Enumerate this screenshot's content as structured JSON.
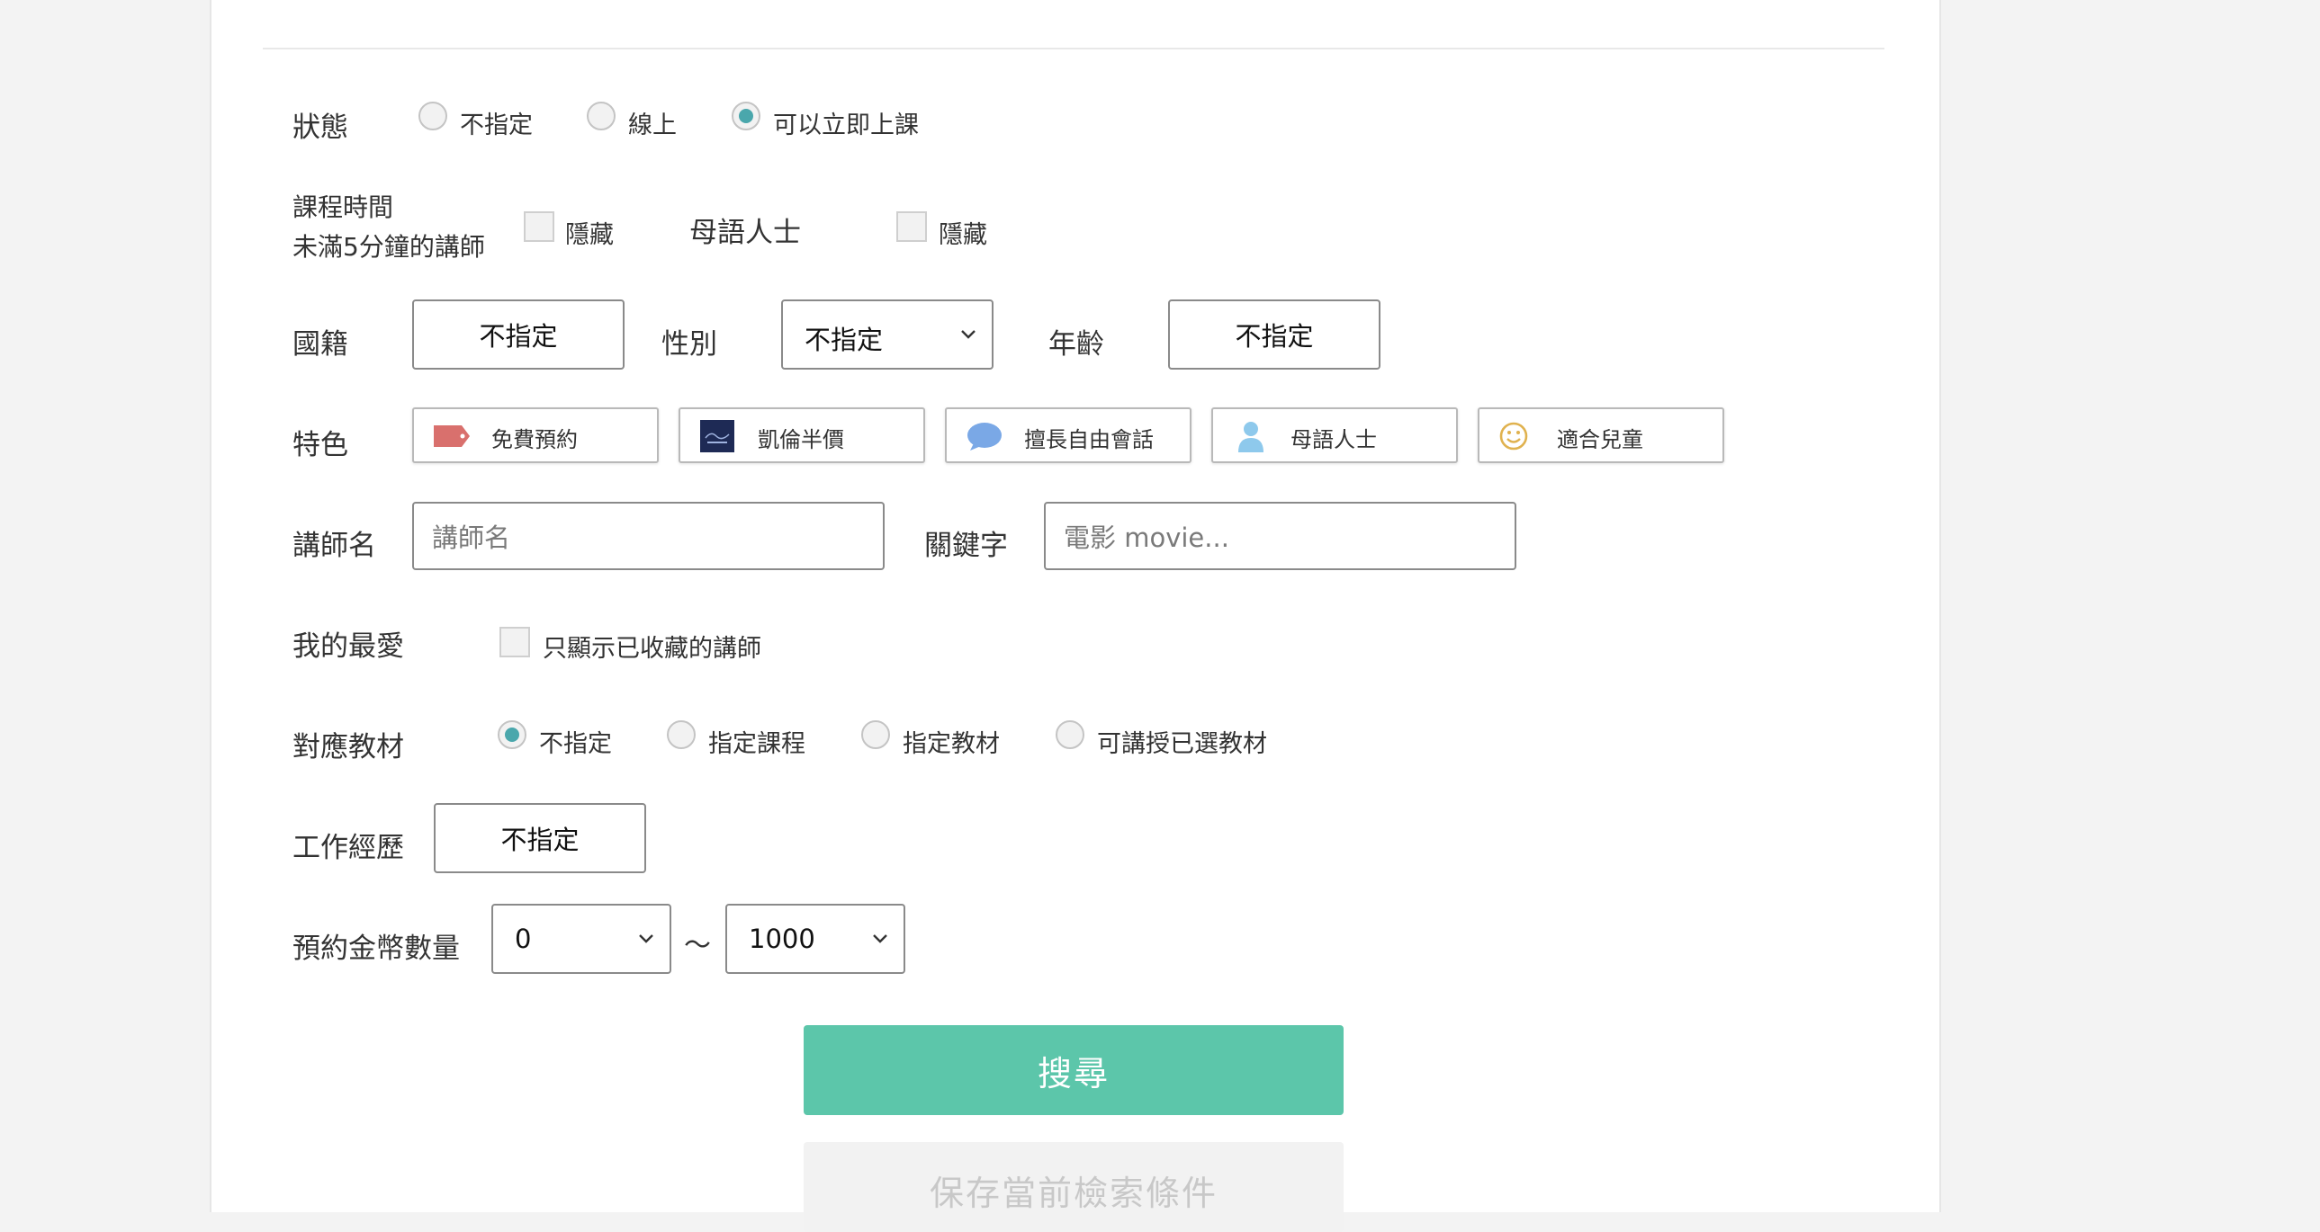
{
  "status": {
    "label": "狀態",
    "options": [
      "不指定",
      "線上",
      "可以立即上課"
    ],
    "selected": "可以立即上課"
  },
  "lesson_time": {
    "label_line1": "課程時間",
    "label_line2": "未滿5分鐘的講師",
    "hide_label": "隱藏"
  },
  "native": {
    "label": "母語人士",
    "hide_label": "隱藏"
  },
  "nationality": {
    "label": "國籍",
    "value": "不指定"
  },
  "gender": {
    "label": "性別",
    "value": "不指定"
  },
  "age": {
    "label": "年齡",
    "value": "不指定"
  },
  "features": {
    "label": "特色",
    "items": [
      {
        "label": "免費預約",
        "icon": "price-tag-icon"
      },
      {
        "label": "凱倫半價",
        "icon": "karen-badge-icon"
      },
      {
        "label": "擅長自由會話",
        "icon": "speech-bubble-icon"
      },
      {
        "label": "母語人士",
        "icon": "person-icon"
      },
      {
        "label": "適合兒童",
        "icon": "smiley-icon"
      }
    ]
  },
  "tutor_name": {
    "label": "講師名",
    "placeholder": "講師名"
  },
  "keyword": {
    "label": "關鍵字",
    "placeholder": "電影 movie..."
  },
  "favorites": {
    "label": "我的最愛",
    "option": "只顯示已收藏的講師"
  },
  "materials": {
    "label": "對應教材",
    "options": [
      "不指定",
      "指定課程",
      "指定教材",
      "可講授已選教材"
    ],
    "selected": "不指定"
  },
  "experience": {
    "label": "工作經歷",
    "value": "不指定"
  },
  "coins": {
    "label": "預約金幣數量",
    "min": "0",
    "separator": "〜",
    "max": "1000"
  },
  "buttons": {
    "search": "搜尋",
    "save": "保存當前檢索條件"
  },
  "colors": {
    "accent": "#5cc6aa",
    "radio_on": "#4aa7ac"
  }
}
